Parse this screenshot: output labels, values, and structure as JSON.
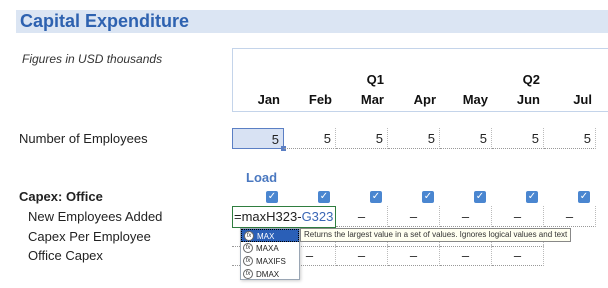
{
  "title": "Capital Expenditure",
  "note": "Figures in USD thousands",
  "quarters": [
    {
      "label": "Q1",
      "col": 2
    },
    {
      "label": "Q2",
      "col": 5
    }
  ],
  "months": [
    "Jan",
    "Feb",
    "Mar",
    "Apr",
    "May",
    "Jun",
    "Jul"
  ],
  "employees_row": {
    "label": "Number of Employees",
    "values": [
      "5",
      "5",
      "5",
      "5",
      "5",
      "5",
      "5"
    ]
  },
  "load_label": "Load",
  "load_checked": [
    true,
    true,
    true,
    true,
    true,
    true,
    true
  ],
  "capex_section": {
    "title": "Capex: Office",
    "rows": [
      {
        "label": "New Employees Added",
        "values": [
          "–",
          "–",
          "–",
          "–",
          "–"
        ]
      },
      {
        "label": "Capex Per Employee",
        "values": [
          "",
          "–",
          "–",
          "–",
          "–",
          "–"
        ]
      },
      {
        "label": "Office Capex",
        "values": [
          "",
          "–",
          "–",
          "–",
          "–",
          "–"
        ]
      }
    ]
  },
  "formula_edit": {
    "prefix": "=maxH323-",
    "ref": "G323"
  },
  "autocomplete": {
    "items": [
      "MAX",
      "MAXA",
      "MAXIFS",
      "DMAX"
    ],
    "active_index": 0,
    "tooltip": "Returns the largest value in a set of values. Ignores logical values and text"
  },
  "colors": {
    "title": "#2e62b0",
    "title_band": "#dbe5f3",
    "checkbox": "#4a86d0",
    "edit_border": "#2f7d3f"
  }
}
